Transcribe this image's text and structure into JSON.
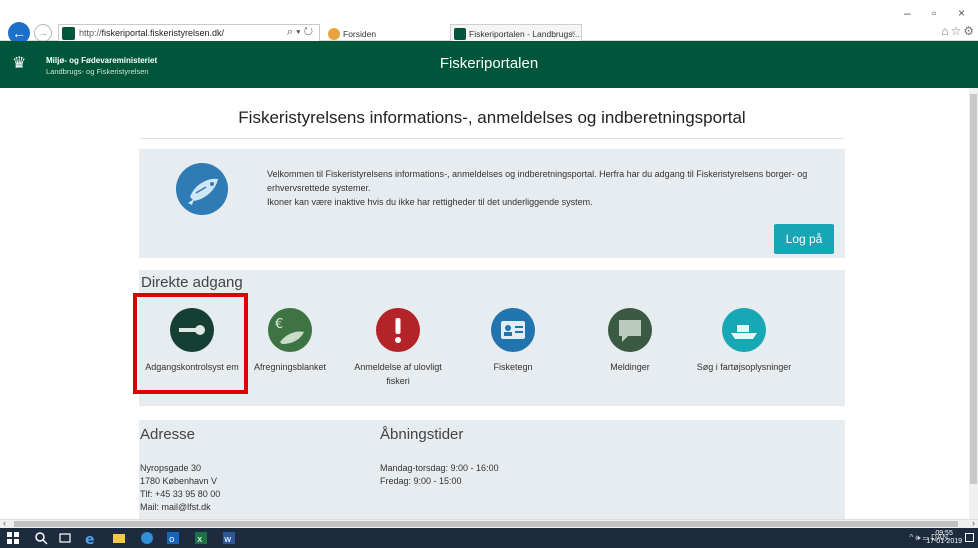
{
  "browser": {
    "url_prefix": "http://",
    "url_host": "fiskeriportal.fiskeristyrelsen.dk/",
    "address_tools": "⌕ ▾ ↻",
    "tabs": [
      {
        "label": "Forsiden",
        "active": false
      },
      {
        "label": "Fiskeriportalen - Landbrugs...",
        "active": true
      }
    ],
    "window_buttons": {
      "minimize": "–",
      "maximize": "▫",
      "close": "×"
    },
    "toolbar_icons": "⌂☆⚙"
  },
  "header": {
    "org_line1": "Miljø- og Fødevareministeriet",
    "org_line2": "Landbrugs- og Fiskeristyrelsen",
    "portal_title": "Fiskeriportalen"
  },
  "page": {
    "heading": "Fiskeristyrelsens informations-, anmeldelses og indberetningsportal",
    "welcome_line1": "Velkommen til Fiskeristyrelsens informations-, anmeldelses og indberetningsportal. Herfra har du adgang til Fiskeristyrelsens borger- og erhvervsrettede systemer.",
    "welcome_line2": "Ikoner kan være inaktive hvis du ikke har rettigheder til det underliggende system.",
    "login_label": "Log på"
  },
  "direct": {
    "title": "Direkte adgang",
    "tiles": [
      {
        "label": "Adgangskontrolsyst em",
        "icon": "key-icon",
        "color": "#163f33"
      },
      {
        "label": "Afregningsblanket",
        "icon": "euro-fish-icon",
        "color": "#3e7343"
      },
      {
        "label": "Anmeldelse af ulovligt fiskeri",
        "icon": "exclamation-icon",
        "color": "#b32328"
      },
      {
        "label": "Fisketegn",
        "icon": "id-card-icon",
        "color": "#2274ae"
      },
      {
        "label": "Meldinger",
        "icon": "speech-bubble-icon",
        "color": "#3a5a43"
      },
      {
        "label": "Søg i fartøjsoplysninger",
        "icon": "ship-icon",
        "color": "#17a8b5"
      }
    ]
  },
  "address": {
    "title": "Adresse",
    "lines": [
      "Nyropsgade 30",
      "1780 København V",
      "Tlf: +45 33 95 80 00",
      "Mail: mail@lfst.dk"
    ]
  },
  "hours": {
    "title": "Åbningstider",
    "lines": [
      "Mandag-torsdag: 9:00 - 16:00",
      "Fredag: 9:00 - 15:00"
    ]
  },
  "taskbar": {
    "tray": "^ 🕪 ▭ DAN",
    "time": "09:55",
    "date": "17-01-2019"
  }
}
